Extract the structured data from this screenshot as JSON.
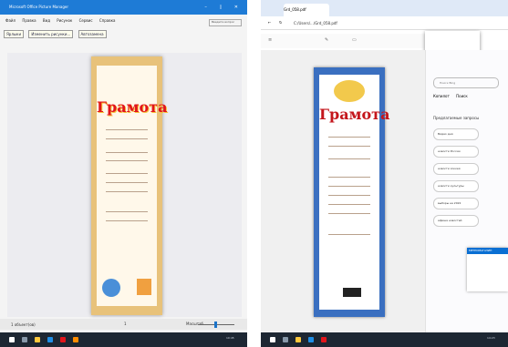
{
  "left_window": {
    "title": "Microsoft Office Picture Manager",
    "window_controls": "– ▯ ✕",
    "menu": [
      "Файл",
      "Правка",
      "Вид",
      "Рисунок",
      "Сервис",
      "Справка"
    ],
    "help_placeholder": "Введите вопрос",
    "toolbar": [
      "Ярлыки",
      "Изменить рисунки...",
      "Автозамена"
    ],
    "document_title": "Грамота",
    "status_left": "1 объект(ов)",
    "status_center": "1",
    "status_zoom_label": "Масштаб",
    "zoom_fraction": 0.45
  },
  "right_window": {
    "tab_title": "Grd_058.pdf",
    "url": "C:/Users/.../Grd_058.pdf",
    "document_title": "Грамота",
    "sidebar": {
      "search_placeholder": "Поиск Bing",
      "tabs": [
        "Копилот",
        "Поиск"
      ],
      "heading": "Предлагаемые запросы",
      "items": [
        "Видео дня",
        "новости России",
        "новости хоккея",
        "новости культуры",
        "выборы на 2022",
        "афиша новостей"
      ],
      "card_header": "МЕТРОМАГАЗИН"
    }
  },
  "taskbar": {
    "left_time": "10:45",
    "right_time": "14:23"
  },
  "colors": {
    "titlebar": "#1e7bd6",
    "taskbar": "#1d2733",
    "grad_red": "#e2151b",
    "browser_tab_bg": "#dfe9f7"
  }
}
